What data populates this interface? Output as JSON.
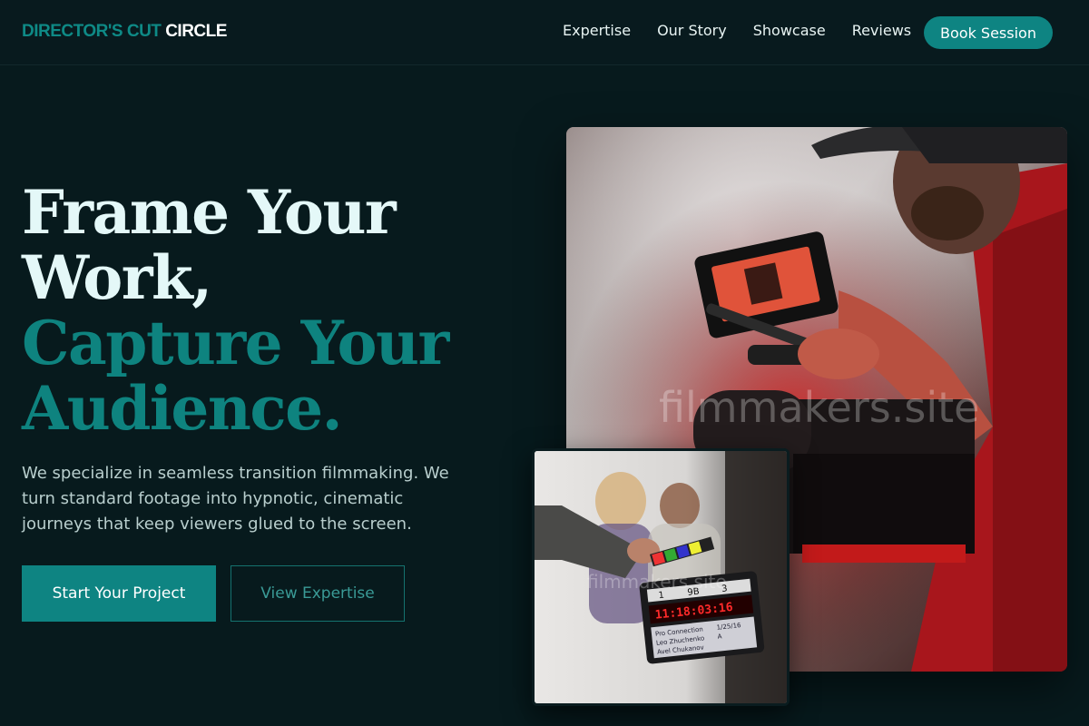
{
  "brand": {
    "part1": "DIRECTOR'S CUT",
    "part2": "CIRCLE"
  },
  "nav": {
    "items": [
      "Expertise",
      "Our Story",
      "Showcase",
      "Reviews"
    ],
    "cta": "Book Session"
  },
  "hero": {
    "line1": "Frame Your",
    "line2": "Work,",
    "line3": "Capture Your",
    "line4": "Audience.",
    "description": "We specialize in seamless transition filmmaking. We turn standard footage into hypnotic, cinematic journeys that keep viewers glued to the screen.",
    "primary_button": "Start Your Project",
    "secondary_button": "View Expertise"
  },
  "images": {
    "main_watermark": "filmmakers.site",
    "secondary_watermark": "filmmakers.site",
    "slate": {
      "row1": [
        "1",
        "9B",
        "3"
      ],
      "timecode": "11:18:03:16",
      "line1": "Pro Connection",
      "line1_date": "1/25/16",
      "line2": "Leo Zhuchenko",
      "line2_code": "A",
      "line3": "Avel Chukanov"
    }
  },
  "colors": {
    "background": "#071a1d",
    "accent": "#0e8482",
    "heading_light": "#e4f8f8",
    "heading_accent": "#0e837f"
  }
}
